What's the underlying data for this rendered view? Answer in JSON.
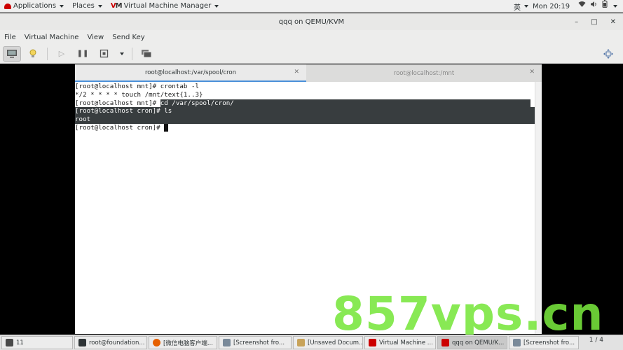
{
  "topbar": {
    "applications": "Applications",
    "places": "Places",
    "app_name": "Virtual Machine Manager",
    "input_method": "英",
    "clock": "Mon 20:19"
  },
  "window": {
    "title": "qqq on QEMU/KVM"
  },
  "menu": [
    "File",
    "Virtual Machine",
    "View",
    "Send Key"
  ],
  "guest": {
    "tabs": [
      {
        "label": "root@localhost:/var/spool/cron",
        "active": true
      },
      {
        "label": "root@localhost:/mnt",
        "active": false
      }
    ],
    "terminal": {
      "lines": [
        "[root@localhost mnt]# crontab -l",
        "*/2 * * * * touch /mnt/text{1..3}",
        "[root@localhost mnt]# ",
        "cd /var/spool/cron/",
        "[root@localhost cron]# ls",
        "root",
        "[root@localhost cron]# "
      ]
    }
  },
  "watermark": "857vps.cn",
  "taskbar": {
    "tasks": [
      {
        "label": "11",
        "color": "#4a4a4a"
      },
      {
        "label": "root@foundation...",
        "color": "#2e3436"
      },
      {
        "label": "[微信电脑客户端...",
        "color": "#e66000"
      },
      {
        "label": "[Screenshot fro...",
        "color": "#7a8a9a"
      },
      {
        "label": "[Unsaved Docum...",
        "color": "#c8a35a"
      },
      {
        "label": "Virtual Machine ...",
        "color": "#cc0000"
      },
      {
        "label": "qqq on QEMU/K...",
        "color": "#cc0000"
      },
      {
        "label": "[Screenshot fro...",
        "color": "#7a8a9a"
      }
    ],
    "pager": "1 / 4"
  }
}
